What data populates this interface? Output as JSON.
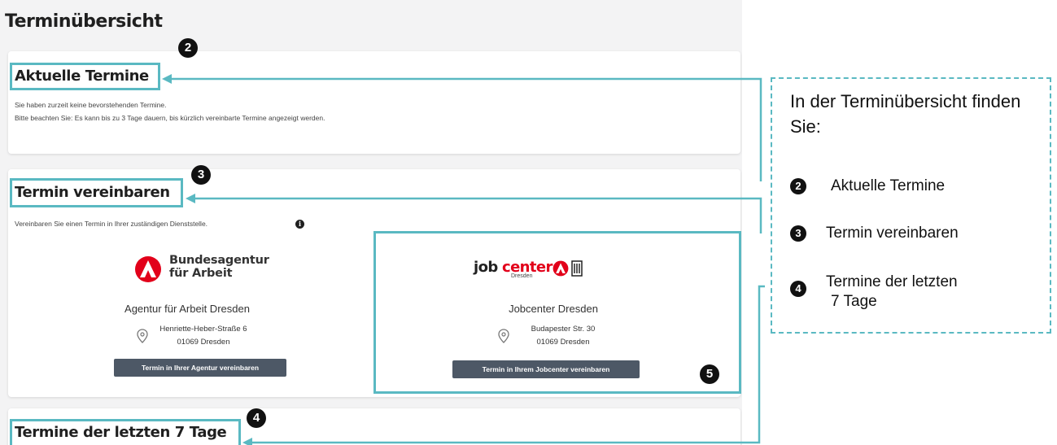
{
  "page": {
    "title": "Terminübersicht"
  },
  "current": {
    "title": "Aktuelle Termine",
    "marker": "2",
    "line1": "Sie haben zurzeit keine bevorstehenden Termine.",
    "line2": "Bitte beachten Sie: Es kann bis zu 3 Tage dauern, bis kürzlich vereinbarte Termine angezeigt werden."
  },
  "book": {
    "title": "Termin vereinbaren",
    "marker": "3",
    "subtitle": "Vereinbaren Sie einen Termin in Ihrer zuständigen Dienststelle.",
    "info_icon": "i",
    "agency": {
      "logo_text_1": "Bundesagentur",
      "logo_text_2": "für Arbeit",
      "name": "Agentur für Arbeit Dresden",
      "street": "Henriette-Heber-Straße 6",
      "city": "01069 Dresden",
      "button": "Termin in Ihrer Agentur vereinbaren"
    },
    "jobcenter": {
      "logo_word_1": "job",
      "logo_word_2": "center",
      "logo_city": "Dresden",
      "name": "Jobcenter Dresden",
      "street": "Budapester Str. 30",
      "city": "01069 Dresden",
      "button": "Termin in Ihrem Jobcenter vereinbaren",
      "marker": "5"
    }
  },
  "past": {
    "title": "Termine der letzten 7 Tage",
    "marker": "4"
  },
  "legend": {
    "title": "In der Terminübersicht finden Sie:",
    "items": [
      {
        "marker": "2",
        "label": "Aktuelle Termine"
      },
      {
        "marker": "3",
        "label": "Termin vereinbaren"
      },
      {
        "marker": "4",
        "label_1": "Termine der letzten",
        "label_2": "7 Tage"
      }
    ]
  },
  "colors": {
    "highlight": "#5ab9c2",
    "brand_red": "#e2001a",
    "button": "#4d5866",
    "jobcenter_dark": "#222222",
    "jobcenter_red": "#e2001a"
  },
  "icons": [
    "info-icon",
    "location-pin-icon",
    "ba-logo-icon",
    "dresden-crest-icon"
  ]
}
